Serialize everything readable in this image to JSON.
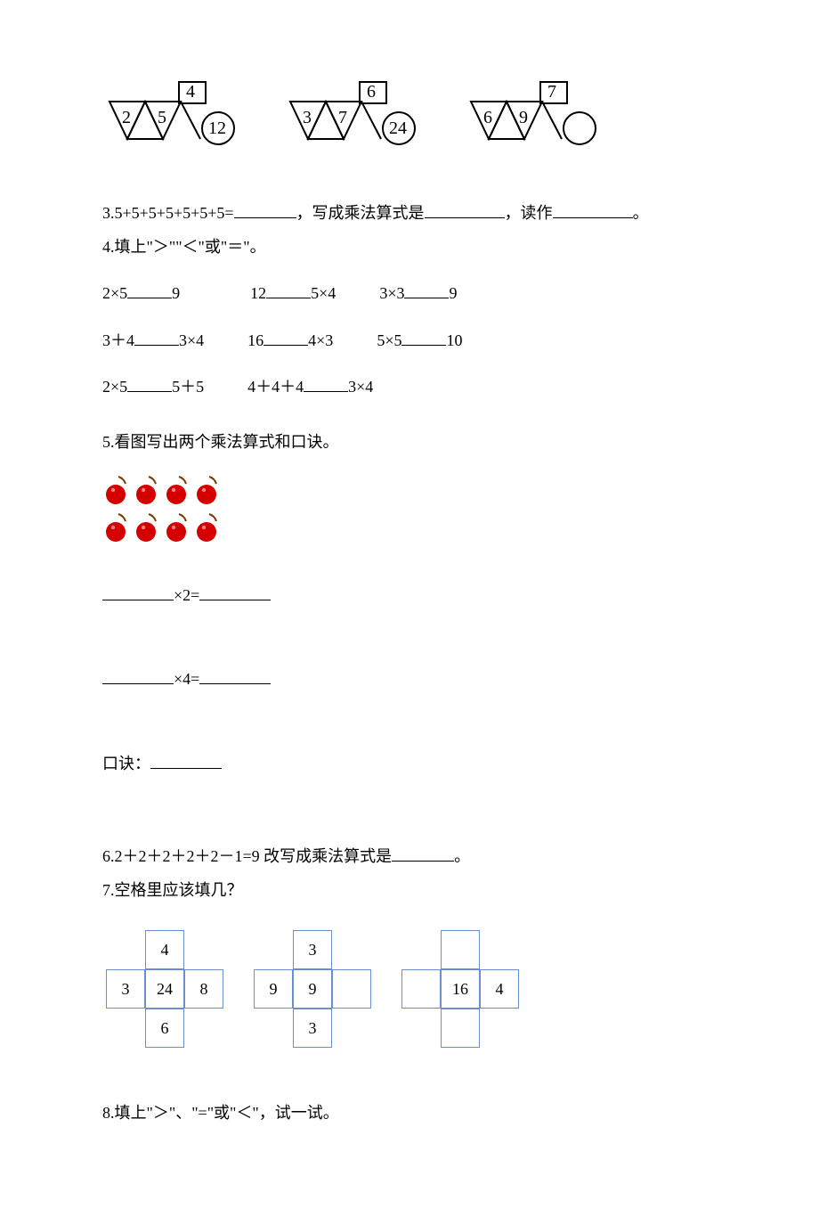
{
  "triangles": [
    {
      "a": "2",
      "b": "5",
      "top": "4",
      "out": "12"
    },
    {
      "a": "3",
      "b": "7",
      "top": "6",
      "out": "24"
    },
    {
      "a": "6",
      "b": "9",
      "top": "7",
      "out": ""
    }
  ],
  "q3": {
    "label": "3.",
    "expr": "5+5+5+5+5+5+5=",
    "seg1": "，写成乘法算式是",
    "seg2": "，读作",
    "seg3": "。"
  },
  "q4": {
    "label": "4.填上\"＞\"\"＜\"或\"＝\"。",
    "rows": [
      [
        {
          "l": "2×5",
          "r": "9"
        },
        {
          "l": "12",
          "r": "5×4"
        },
        {
          "l": "3×3",
          "r": "9"
        }
      ],
      [
        {
          "l": "3＋4",
          "r": "3×4"
        },
        {
          "l": "16",
          "r": "4×3"
        },
        {
          "l": "5×5",
          "r": "10"
        }
      ],
      [
        {
          "l": "2×5",
          "r": "5＋5"
        },
        {
          "l": "4＋4＋4",
          "r": "3×4"
        }
      ]
    ]
  },
  "q5": {
    "label": "5.看图写出两个乘法算式和口诀。",
    "eq1_mid": "×2=",
    "eq2_mid": "×4=",
    "mnemonic_label": "口诀："
  },
  "q6": {
    "pre": "6.",
    "expr": "2＋2＋2＋2＋2－1=9 改写成乘法算式是",
    "suffix": "。"
  },
  "q7": {
    "label": "7.空格里应该填几？",
    "crosses": [
      {
        "top": "4",
        "left": "3",
        "center": "24",
        "right": "8",
        "bottom": "6"
      },
      {
        "top": "3",
        "left": "9",
        "center": "9",
        "right": "",
        "bottom": "3"
      },
      {
        "top": "",
        "left": "",
        "center": "16",
        "right": "4",
        "bottom": ""
      }
    ]
  },
  "q8": {
    "label": "8.填上\"＞\"、\"=\"或\"＜\"，试一试。"
  }
}
